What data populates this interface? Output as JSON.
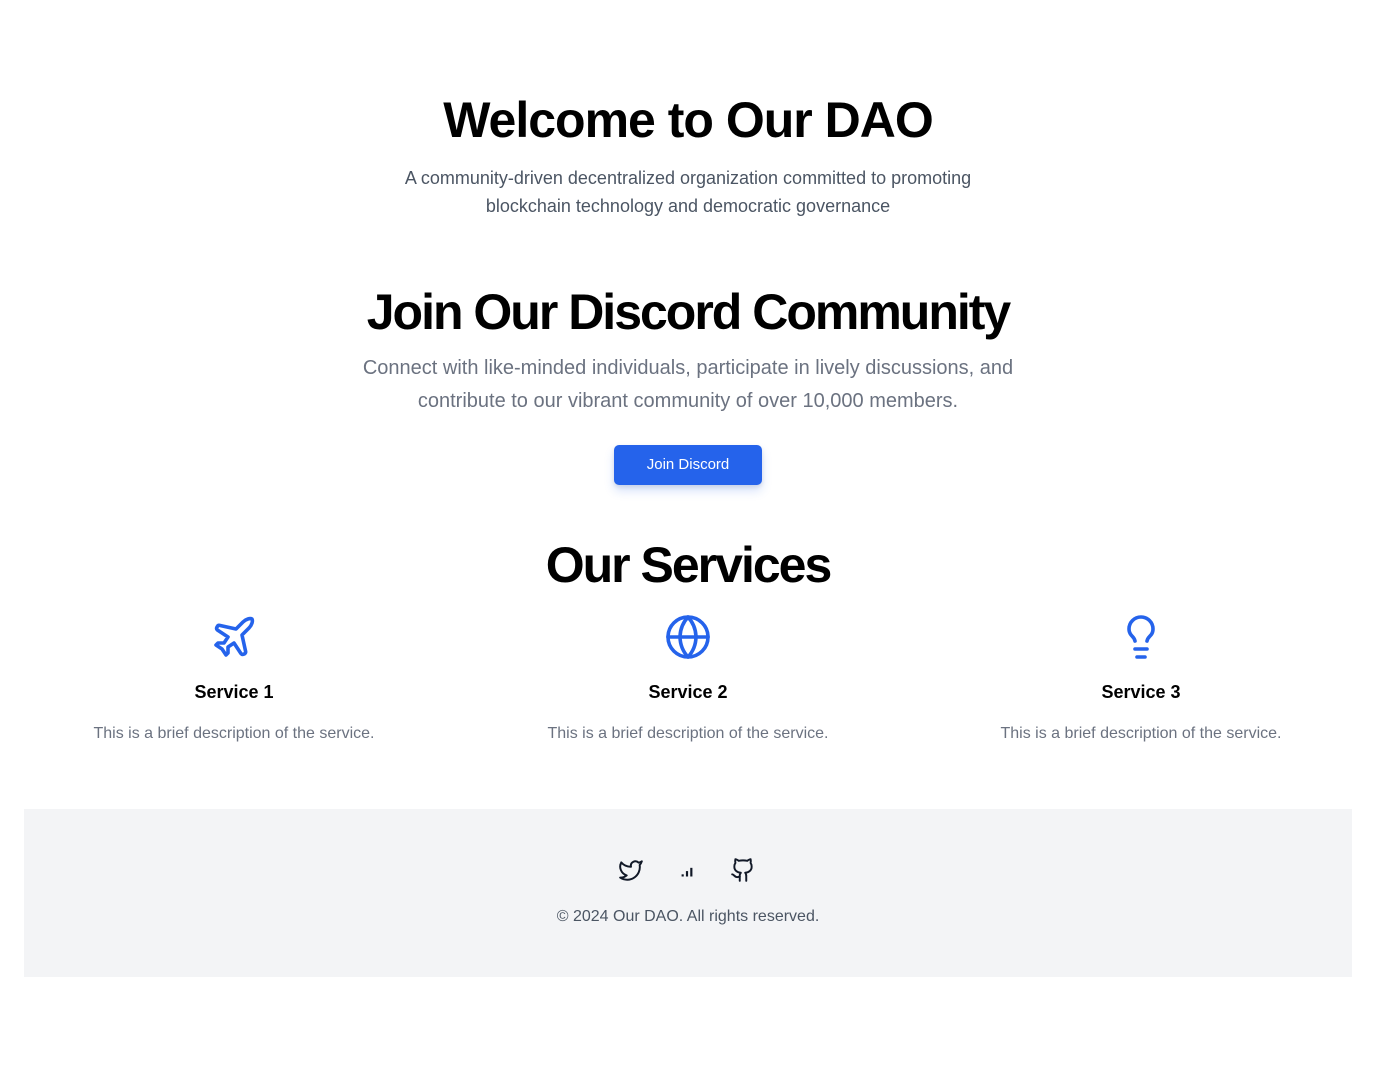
{
  "hero": {
    "title": "Welcome to Our DAO",
    "subtitle": "A community-driven decentralized organization committed to promoting blockchain technology and democratic governance"
  },
  "discord": {
    "title": "Join Our Discord Community",
    "subtitle": "Connect with like-minded individuals, participate in lively discussions, and contribute to our vibrant community of over 10,000 members.",
    "button_label": "Join Discord",
    "accent_color": "#2563eb"
  },
  "services": {
    "title": "Our Services",
    "icon_color": "#2563eb",
    "items": [
      {
        "icon": "plane-icon",
        "name": "Service 1",
        "description": "This is a brief description of the service."
      },
      {
        "icon": "globe-icon",
        "name": "Service 2",
        "description": "This is a brief description of the service."
      },
      {
        "icon": "lightbulb-icon",
        "name": "Service 3",
        "description": "This is a brief description of the service."
      }
    ]
  },
  "footer": {
    "social_icons": [
      "twitter-icon",
      "signal-icon",
      "github-icon"
    ],
    "copyright": "© 2024 Our DAO. All rights reserved.",
    "background": "#f3f4f6"
  }
}
